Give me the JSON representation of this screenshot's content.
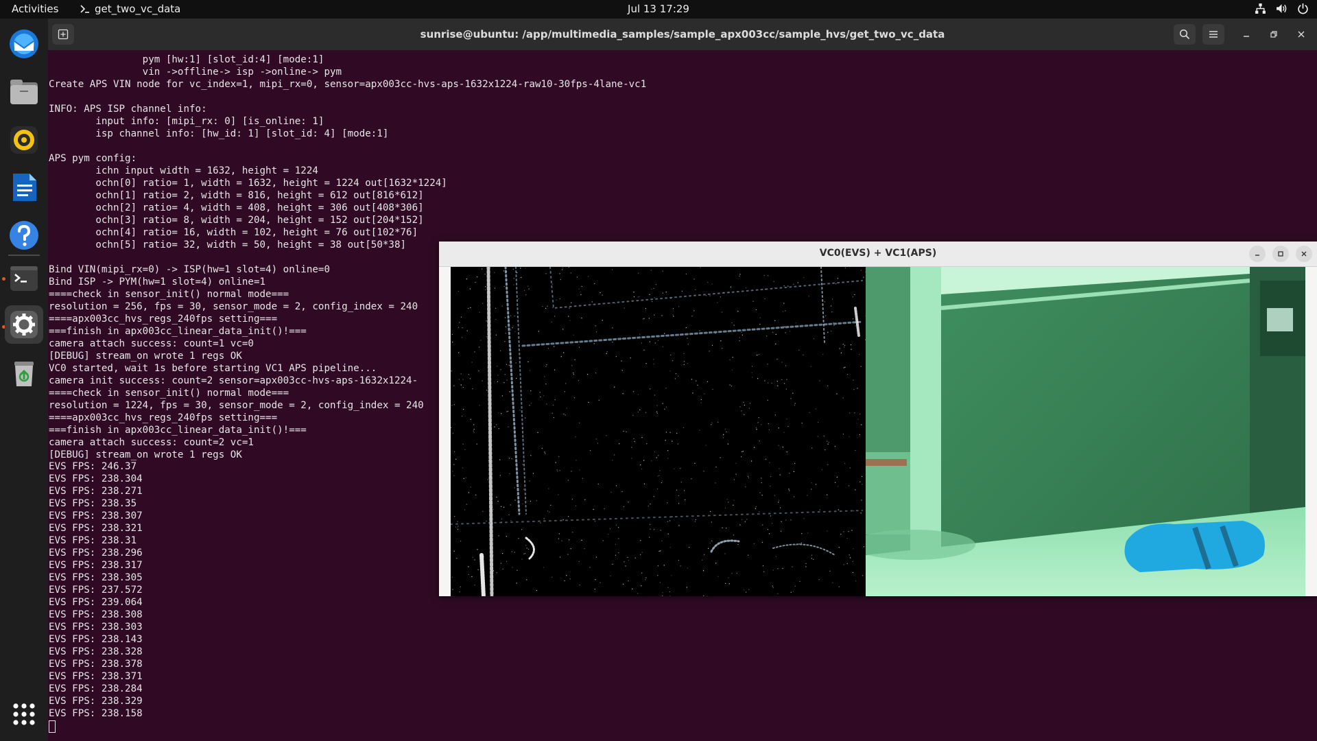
{
  "topbar": {
    "activities": "Activities",
    "app_name": "get_two_vc_data",
    "clock": "Jul 13  17:29",
    "tray_icons": [
      "network-icon",
      "volume-icon",
      "power-icon"
    ]
  },
  "dock": {
    "items": [
      {
        "name": "thunderbird",
        "icon": "thunderbird-icon"
      },
      {
        "name": "files",
        "icon": "files-icon"
      },
      {
        "name": "rhythmbox",
        "icon": "rhythmbox-icon"
      },
      {
        "name": "writer",
        "icon": "writer-icon"
      },
      {
        "name": "help",
        "icon": "help-icon"
      },
      {
        "name": "terminal",
        "icon": "terminal-icon",
        "running": true
      },
      {
        "name": "settings",
        "icon": "settings-icon",
        "running": true,
        "active": true
      },
      {
        "name": "trash",
        "icon": "trash-icon"
      },
      {
        "name": "show-apps",
        "icon": "app-grid-icon"
      }
    ]
  },
  "terminal": {
    "title": "sunrise@ubuntu: /app/multimedia_samples/sample_apx003cc/sample_hvs/get_two_vc_data",
    "lines": [
      "                pym [hw:1] [slot_id:4] [mode:1]",
      "                vin ->offline-> isp ->online-> pym",
      "Create APS VIN node for vc_index=1, mipi_rx=0, sensor=apx003cc-hvs-aps-1632x1224-raw10-30fps-4lane-vc1",
      "",
      "INFO: APS ISP channel info:",
      "        input info: [mipi_rx: 0] [is_online: 1]",
      "        isp channel info: [hw_id: 1] [slot_id: 4] [mode:1]",
      "",
      "APS pym config:",
      "        ichn input width = 1632, height = 1224",
      "        ochn[0] ratio= 1, width = 1632, height = 1224 out[1632*1224]",
      "        ochn[1] ratio= 2, width = 816, height = 612 out[816*612]",
      "        ochn[2] ratio= 4, width = 408, height = 306 out[408*306]",
      "        ochn[3] ratio= 8, width = 204, height = 152 out[204*152]",
      "        ochn[4] ratio= 16, width = 102, height = 76 out[102*76]",
      "        ochn[5] ratio= 32, width = 50, height = 38 out[50*38]",
      "",
      "Bind VIN(mipi_rx=0) -> ISP(hw=1 slot=4) online=0",
      "Bind ISP -> PYM(hw=1 slot=4) online=1",
      "====check in sensor_init() normal mode===",
      "resolution = 256, fps = 30, sensor_mode = 2, config_index = 240",
      "====apx003cc_hvs_regs_240fps setting===",
      "===finish in apx003cc_linear_data_init()!===",
      "camera attach success: count=1 vc=0",
      "[DEBUG] stream_on wrote 1 regs OK",
      "VC0 started, wait 1s before starting VC1 APS pipeline...",
      "camera init success: count=2 sensor=apx003cc-hvs-aps-1632x1224-",
      "====check in sensor_init() normal mode===",
      "resolution = 1224, fps = 30, sensor_mode = 2, config_index = 240",
      "====apx003cc_hvs_regs_240fps setting===",
      "===finish in apx003cc_linear_data_init()!===",
      "camera attach success: count=2 vc=1",
      "[DEBUG] stream_on wrote 1 regs OK",
      "EVS FPS: 246.37",
      "EVS FPS: 238.304",
      "EVS FPS: 238.271",
      "EVS FPS: 238.35",
      "EVS FPS: 238.307",
      "EVS FPS: 238.321",
      "EVS FPS: 238.31",
      "EVS FPS: 238.296",
      "EVS FPS: 238.317",
      "EVS FPS: 238.305",
      "EVS FPS: 237.572",
      "EVS FPS: 239.064",
      "EVS FPS: 238.308",
      "EVS FPS: 238.303",
      "EVS FPS: 238.143",
      "EVS FPS: 238.328",
      "EVS FPS: 238.378",
      "EVS FPS: 238.371",
      "EVS FPS: 238.284",
      "EVS FPS: 238.329",
      "EVS FPS: 238.158"
    ]
  },
  "viewer": {
    "title": "VC0(EVS) + VC1(APS)"
  },
  "colors": {
    "terminal_bg": "#300a24",
    "accent": "#e95420"
  }
}
